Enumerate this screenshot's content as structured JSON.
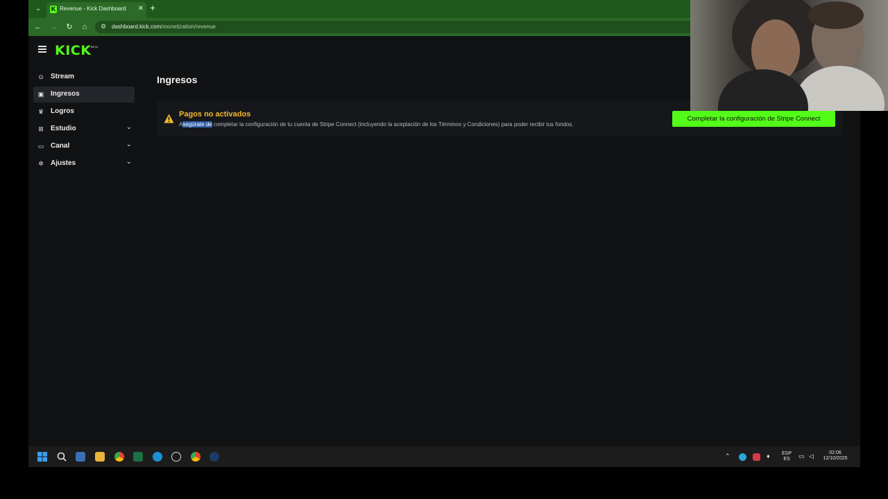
{
  "browser": {
    "tab_title": "Revenue - Kick Dashboard",
    "tab_favicon": "K",
    "url_host": "dashboard.kick.com",
    "url_path": "/monetization/revenue"
  },
  "brand": {
    "logo": "KICK",
    "badge": "BETA",
    "accent": "#53fc18"
  },
  "sidebar": {
    "items": [
      {
        "label": "Stream",
        "icon": "broadcast-icon"
      },
      {
        "label": "Ingresos",
        "icon": "revenue-icon",
        "active": true
      },
      {
        "label": "Logros",
        "icon": "trophy-icon"
      },
      {
        "label": "Estudio",
        "icon": "studio-icon",
        "expandable": true
      },
      {
        "label": "Canal",
        "icon": "channel-icon",
        "expandable": true
      },
      {
        "label": "Ajustes",
        "icon": "gear-icon",
        "expandable": true
      }
    ]
  },
  "main": {
    "title": "Ingresos",
    "alert": {
      "title": "Pagos no activados",
      "text_first": "A",
      "text_selected": "segúrate de",
      "text_rest": " completar la configuración de tu cuenta de Stripe Connect (incluyendo la aceptación de los Términos y Condiciones) para poder recibir tus fondos.",
      "color": "#f5b92e"
    },
    "button_label": "Completar la configuración de Stripe Connect"
  },
  "taskbar": {
    "lang_top": "ESP",
    "lang_bottom": "ES",
    "time": "02:06",
    "date": "12/10/2025"
  }
}
